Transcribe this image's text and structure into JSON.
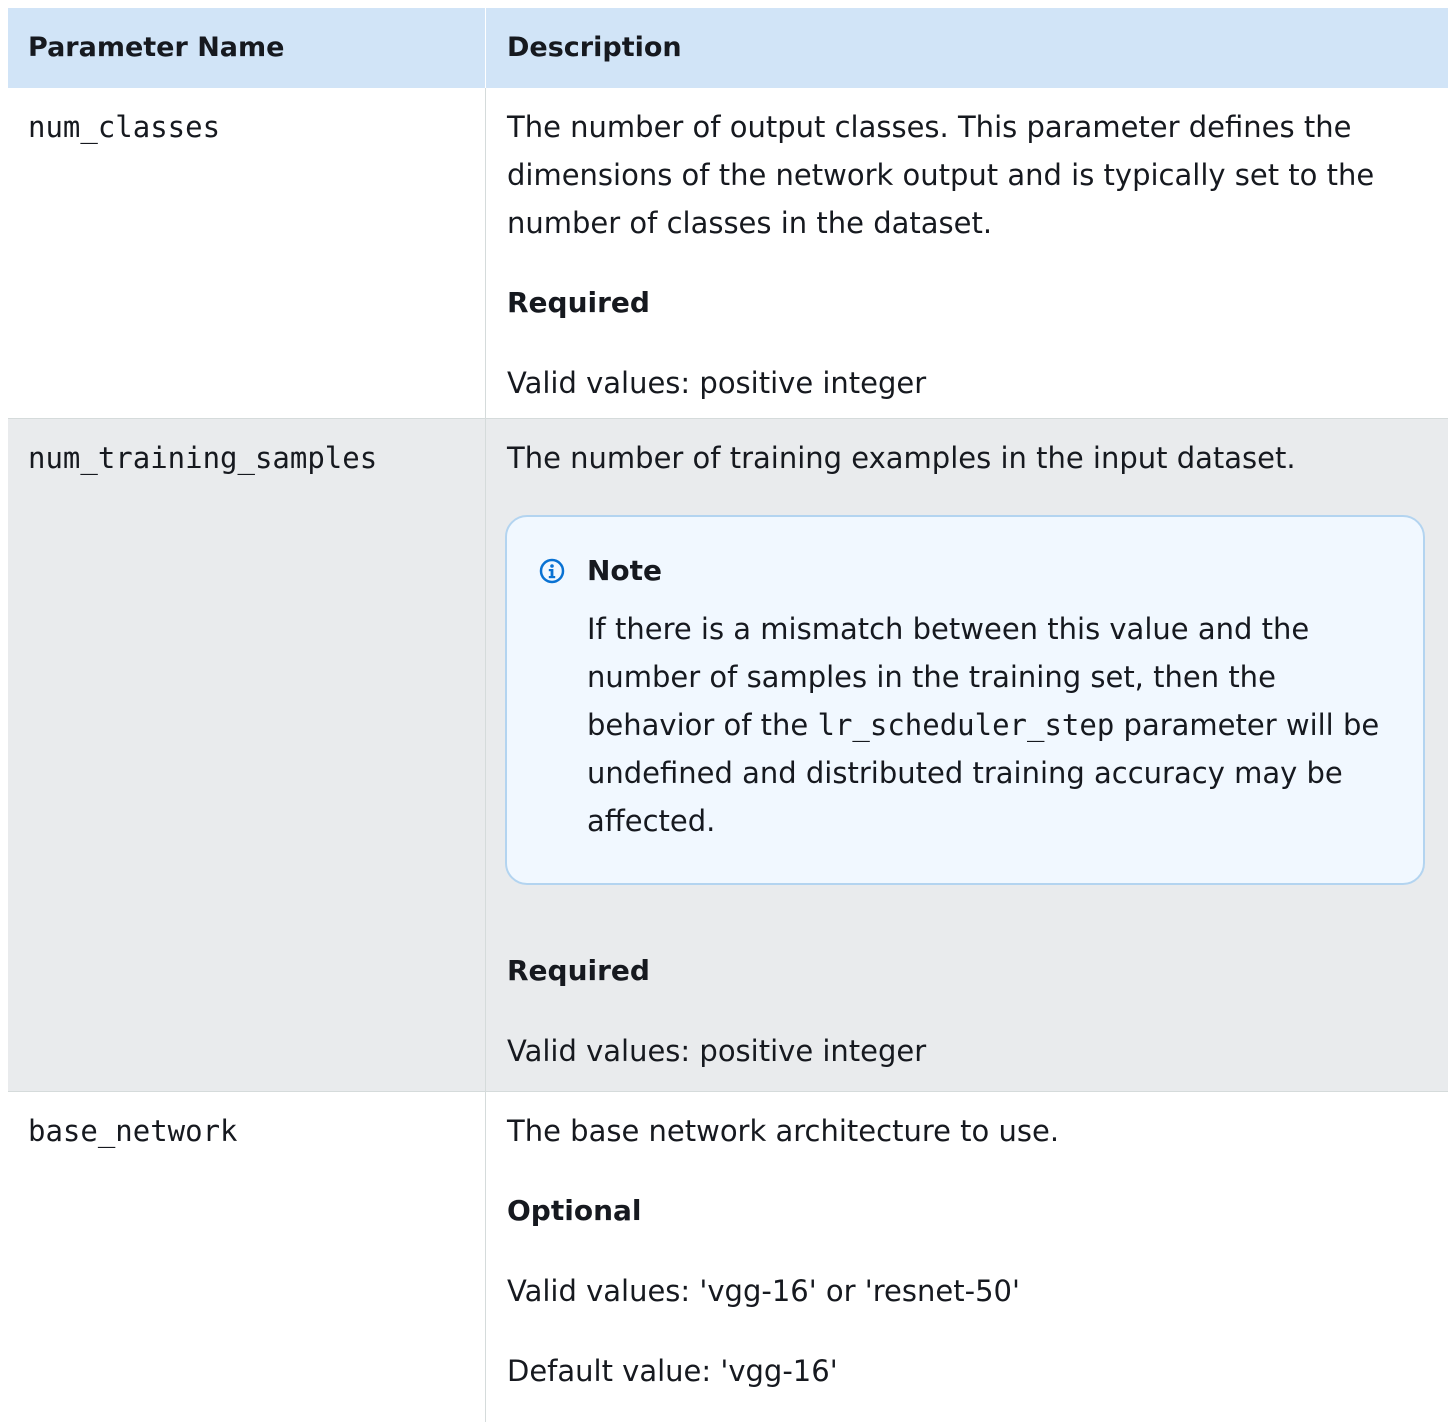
{
  "header": {
    "col_name": "Parameter Name",
    "col_desc": "Description"
  },
  "rows": [
    {
      "name": "num_classes",
      "description": "The number of output classes. This parameter defines the dimensions of the network output and is typically set to the number of classes in the dataset.",
      "requirement": "Required",
      "valid_values": "Valid values: positive integer"
    },
    {
      "name": "num_training_samples",
      "description": "The number of training examples in the input dataset.",
      "note": {
        "title": "Note",
        "text_before": "If there is a mismatch between this value and the number of samples in the training set, then the behavior of the ",
        "code": "lr_scheduler_step",
        "text_after": " parameter will be undefined and distributed training accuracy may be affected."
      },
      "requirement": "Required",
      "valid_values": "Valid values: positive integer"
    },
    {
      "name": "base_network",
      "description": "The base network architecture to use.",
      "requirement": "Optional",
      "valid_values": "Valid values: 'vgg-16' or 'resnet-50'",
      "default_value": "Default value: 'vgg-16'"
    }
  ],
  "colors": {
    "header_bg": "#d1e4f7",
    "alt_row_bg": "#e9ebed",
    "note_bg": "#f1f8ff",
    "note_border": "#b3d4f0",
    "info_icon": "#0972d3"
  },
  "icons": {
    "note_icon": "info-icon"
  }
}
